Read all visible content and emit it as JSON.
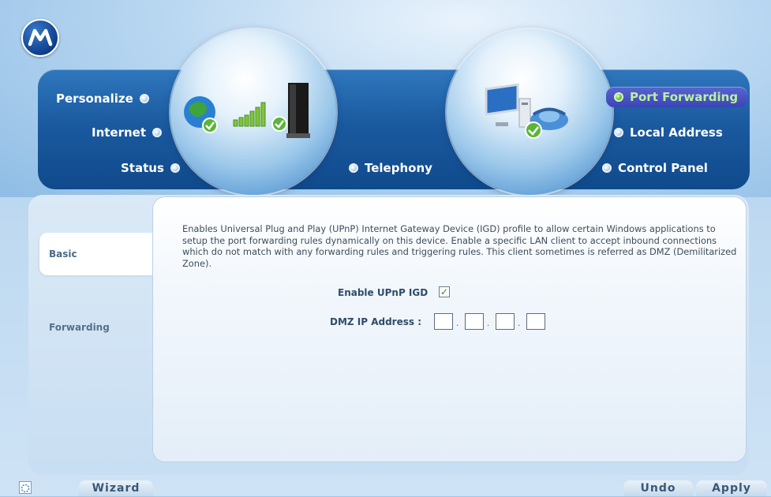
{
  "brand": {
    "logo_icon": "motorola-logo-icon"
  },
  "nav": {
    "left": [
      {
        "label": "Personalize",
        "icon": "radio-dot-icon"
      },
      {
        "label": "Internet",
        "icon": "radio-dot-icon"
      },
      {
        "label": "Status",
        "icon": "radio-dot-icon"
      }
    ],
    "center": {
      "label": "Telephony",
      "icon": "radio-dot-icon"
    },
    "right": [
      {
        "label": "Port Forwarding",
        "icon": "radio-dot-icon",
        "active": true
      },
      {
        "label": "Local Address",
        "icon": "radio-dot-icon"
      },
      {
        "label": "Control Panel",
        "icon": "radio-dot-icon"
      }
    ]
  },
  "tabs": [
    {
      "label": "Basic",
      "active": true
    },
    {
      "label": "Forwarding",
      "active": false
    }
  ],
  "content": {
    "description": "Enables Universal Plug and Play (UPnP) Internet Gateway Device (IGD) profile to allow certain Windows applications to setup the port forwarding rules dynamically on this device. Enable a specific LAN client to accept inbound connections which do not match with any forwarding rules and triggering rules. This client sometimes is referred as DMZ (Demilitarized Zone).",
    "upnp_label": "Enable UPnP IGD",
    "upnp_checked": true,
    "upnp_check_glyph": "✓",
    "dmz_label": "DMZ IP Address :",
    "dmz_octets": [
      "",
      "",
      "",
      ""
    ],
    "ip_separator": "."
  },
  "footer": {
    "wizard_label": "Wizard",
    "undo_label": "Undo",
    "apply_label": "Apply"
  },
  "colors": {
    "nav_band": "#1b5a9f",
    "active_nav": "#3b45b6",
    "active_nav_text": "#b9f29c",
    "panel_bg": "#ffffff"
  }
}
